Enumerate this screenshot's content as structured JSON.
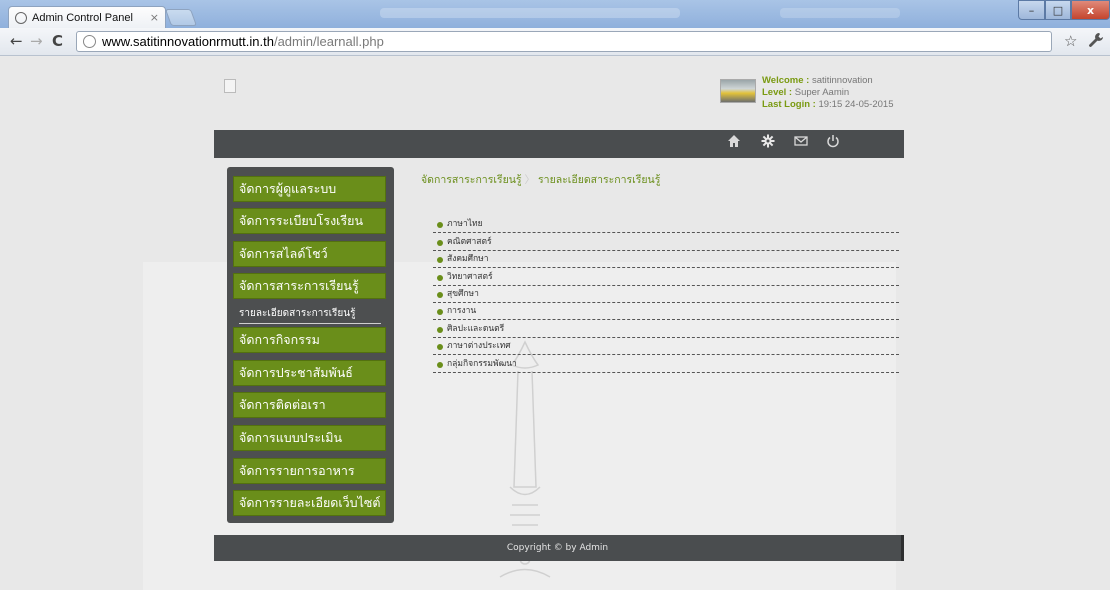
{
  "browser": {
    "tab_title": "Admin Control Panel",
    "tab_close": "×",
    "url_host": "www.satitinnovationrmutt.in.th",
    "url_path": "/admin/learnall.php",
    "window_controls": {
      "minimize": "–",
      "maximize": "□",
      "close": "x"
    },
    "nav": {
      "back": "←",
      "forward": "→",
      "reload": "C"
    },
    "star": "☆",
    "wrench": "🔧"
  },
  "user": {
    "welcome_label": "Welcome :",
    "welcome_value": " satitinnovation",
    "level_label": "Level :",
    "level_value": " Super Aamin",
    "login_label": "Last Login :",
    "login_value": " 19:15 24-05-2015"
  },
  "topbar_icons": [
    "home-icon",
    "gear-icon",
    "mail-icon",
    "power-icon"
  ],
  "sidebar": {
    "items": [
      {
        "label": "จัดการผู้ดูแลระบบ"
      },
      {
        "label": "จัดการระเบียบโรงเรียน"
      },
      {
        "label": "จัดการสไลด์โชว์"
      },
      {
        "label": "จัดการสาระการเรียนรู้"
      },
      {
        "label": "จัดการกิจกรรม"
      },
      {
        "label": "จัดการประชาสัมพันธ์"
      },
      {
        "label": "จัดการติดต่อเรา"
      },
      {
        "label": "จัดการแบบประเมิน"
      },
      {
        "label": "จัดการรายการอาหาร"
      },
      {
        "label": "จัดการรายละเอียดเว็บไซต์"
      }
    ],
    "subitem": "รายละเอียดสาระการเรียนรู้"
  },
  "breadcrumb": {
    "parent": "จัดการสาระการเรียนรู้",
    "separator": "〉",
    "current": "รายละเอียดสาระการเรียนรู้"
  },
  "subjects": [
    "ภาษาไทย",
    "คณิตศาสตร์",
    "สังคมศึกษา",
    "วิทยาศาสตร์",
    "สุขศึกษา",
    "การงาน",
    "ศิลปะและดนตรี",
    "ภาษาต่างประเทศ",
    "กลุ่มกิจกรรมพัฒนา"
  ],
  "footer": {
    "text": "Copyright © by Admin"
  },
  "colors": {
    "accent_green": "#6a8e1a",
    "dark_bar": "#4a4d4f",
    "page_bg": "#e8e8e8"
  }
}
